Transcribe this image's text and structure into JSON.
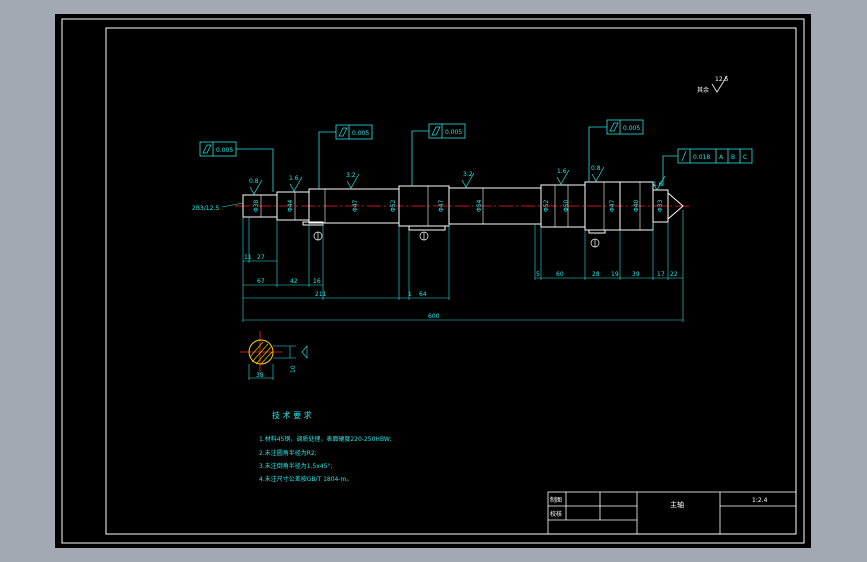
{
  "drawing": {
    "roughness_note": "其余",
    "roughness_value": "12.5",
    "callouts": [
      {
        "value": "0.005"
      },
      {
        "value": "0.005"
      },
      {
        "value": "0.005"
      },
      {
        "value": "0.005"
      }
    ],
    "runout": {
      "value": "0.018",
      "datum_a": "A",
      "datum_b": "B",
      "datum_c": "C"
    },
    "center_hole_label": "2B3/12.5",
    "surface_marks": [
      "0.8",
      "1.6",
      "3.2",
      "3.2",
      "1.6",
      "0.8",
      "1.6"
    ],
    "diameters": [
      "Φ38",
      "Φ44",
      "Φ47",
      "Φ52",
      "Φ47",
      "Φ54",
      "Φ52",
      "Φ50",
      "Φ47",
      "Φ40",
      "Φ33"
    ],
    "dims_row1": [
      "11",
      "27"
    ],
    "dims_row2_left": [
      "67",
      "42",
      "16"
    ],
    "dims_row2_right": [
      "5",
      "60",
      "28",
      "19",
      "39",
      "17",
      "22"
    ],
    "dims_row3": [
      "211",
      "1",
      "64"
    ],
    "overall_length": "600",
    "section_dims": [
      "38",
      "10"
    ],
    "tech_title": "技 术 要 求",
    "tech_items": [
      "1.材料45钢，调质处理，表面硬度220-250HBW;",
      "2.未注圆角半径为R2;",
      "3.未注倒角半径为1.5x45°;",
      "4.未注尺寸公差按GB/T 1804-m。"
    ],
    "title_block": {
      "drawn_label": "制图",
      "checked_label": "校核",
      "part_name": "主轴",
      "scale": "1:2.4"
    }
  }
}
